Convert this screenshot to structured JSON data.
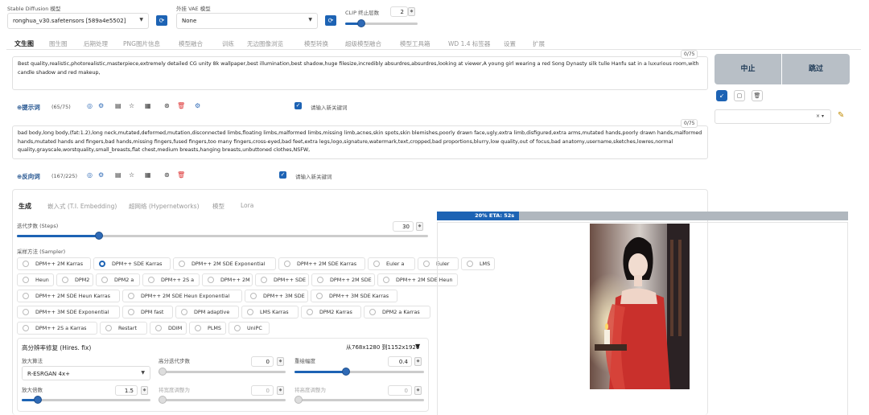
{
  "model": {
    "label": "Stable Diffusion 模型",
    "value": "ronghua_v30.safetensors [589a4e5502]"
  },
  "vae": {
    "label": "外挂 VAE 模型",
    "value": "None"
  },
  "clip": {
    "label": "CLIP 终止层数",
    "value": "2"
  },
  "tabs": [
    "文生图",
    "图生图",
    "后期处理",
    "PNG图片信息",
    "模型融合",
    "训练",
    "无边图像浏览",
    "模型转换",
    "超级模型融合",
    "模型工具箱",
    "WD 1.4 标签器",
    "设置",
    "扩展"
  ],
  "prompt": {
    "text": "Best quality,realistic,photorealistic,masterpiece,extremely detailed CG unity 8k wallpaper,best illumination,best shadow,huge filesize,incredibly absurdres,absurdres,looking at viewer,A young girl wearing a red Song Dynasty silk tulle Hanfu sat in a luxurious room,with candle shadow and red makeup,",
    "counter": "0/75",
    "title": "提示词",
    "count": "(65/75)",
    "newkw": "请输入新关键词"
  },
  "negative": {
    "text": "bad body,long body,(fat:1.2),long neck,mutated,deformed,mutation,disconnected limbs,floating limbs,malformed limbs,missing limb,acnes,skin spots,skin blemishes,poorly drawn face,ugly,extra limb,disfigured,extra arms,mutated hands,poorly drawn hands,malformed hands,mutated hands and fingers,bad hands,missing fingers,fused fingers,too many fingers,cross-eyed,bad feet,extra legs,logo,signature,watermark,text,cropped,bad proportions,blurry,low quality,out of focus,bad anatomy,username,sketches,lowres,normal quality,grayscale,worstquality,small_breasts,flat chest,medium breasts,hanging breasts,unbuttoned clothes,NSFW,",
    "counter": "0/75",
    "title": "反向词",
    "count": "(167/225)",
    "newkw": "请输入新关键词"
  },
  "actions": {
    "interrupt": "中止",
    "skip": "跳过"
  },
  "subtabs": [
    "生成",
    "嵌入式 (T.I. Embedding)",
    "超网络 (Hypernetworks)",
    "模型",
    "Lora"
  ],
  "steps": {
    "label": "迭代步数 (Steps)",
    "value": "30",
    "fraction": 0.2
  },
  "sampler": {
    "label": "采样方法 (Sampler)",
    "selected": "DPM++ SDE Karras",
    "options": [
      "DPM++ 2M Karras",
      "DPM++ SDE Karras",
      "DPM++ 2M SDE Exponential",
      "DPM++ 2M SDE Karras",
      "Euler a",
      "Euler",
      "LMS",
      "Heun",
      "DPM2",
      "DPM2 a",
      "DPM++ 2S a",
      "DPM++ 2M",
      "DPM++ SDE",
      "DPM++ 2M SDE",
      "DPM++ 2M SDE Heun",
      "DPM++ 2M SDE Heun Karras",
      "DPM++ 2M SDE Heun Exponential",
      "DPM++ 3M SDE",
      "DPM++ 3M SDE Karras",
      "DPM++ 3M SDE Exponential",
      "DPM fast",
      "DPM adaptive",
      "LMS Karras",
      "DPM2 Karras",
      "DPM2 a Karras",
      "DPM++ 2S a Karras",
      "Restart",
      "DDIM",
      "PLMS",
      "UniPC"
    ]
  },
  "hires": {
    "title": "高分辨率修复 (Hires. fix)",
    "info": "从768x1280 到1152x1920",
    "upscaler_label": "放大算法",
    "upscaler": "R-ESRGAN 4x+",
    "steps_label": "高分迭代步数",
    "steps": "0",
    "denoise_label": "重绘幅度",
    "denoise": "0.4",
    "scale_label": "放大倍数",
    "scale": "1.5",
    "w_label": "将宽度调整为",
    "w": "0",
    "h_label": "将高度调整为",
    "h": "0",
    "steps_fraction": 0,
    "denoise_fraction": 0.4,
    "scale_fraction": 0.125
  },
  "progress": {
    "text": "20% ETA: 52s",
    "fraction": 0.2
  }
}
